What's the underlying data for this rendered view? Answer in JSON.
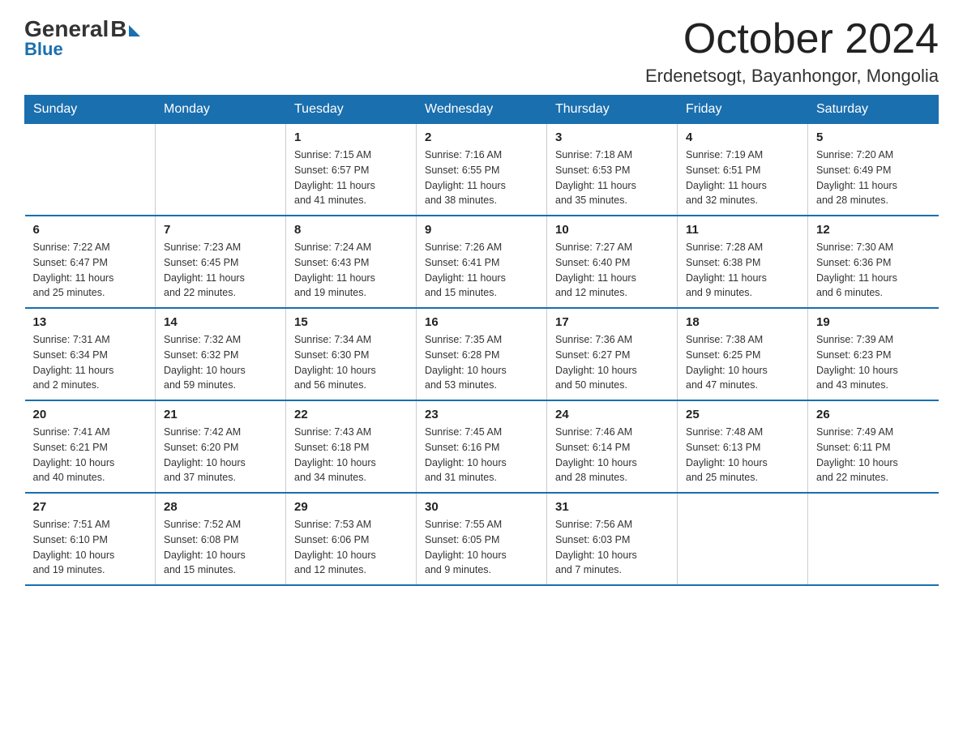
{
  "logo": {
    "general": "General",
    "blue": "Blue"
  },
  "title": "October 2024",
  "location": "Erdenetsogt, Bayanhongor, Mongolia",
  "days_of_week": [
    "Sunday",
    "Monday",
    "Tuesday",
    "Wednesday",
    "Thursday",
    "Friday",
    "Saturday"
  ],
  "weeks": [
    [
      {
        "day": "",
        "info": ""
      },
      {
        "day": "",
        "info": ""
      },
      {
        "day": "1",
        "info": "Sunrise: 7:15 AM\nSunset: 6:57 PM\nDaylight: 11 hours\nand 41 minutes."
      },
      {
        "day": "2",
        "info": "Sunrise: 7:16 AM\nSunset: 6:55 PM\nDaylight: 11 hours\nand 38 minutes."
      },
      {
        "day": "3",
        "info": "Sunrise: 7:18 AM\nSunset: 6:53 PM\nDaylight: 11 hours\nand 35 minutes."
      },
      {
        "day": "4",
        "info": "Sunrise: 7:19 AM\nSunset: 6:51 PM\nDaylight: 11 hours\nand 32 minutes."
      },
      {
        "day": "5",
        "info": "Sunrise: 7:20 AM\nSunset: 6:49 PM\nDaylight: 11 hours\nand 28 minutes."
      }
    ],
    [
      {
        "day": "6",
        "info": "Sunrise: 7:22 AM\nSunset: 6:47 PM\nDaylight: 11 hours\nand 25 minutes."
      },
      {
        "day": "7",
        "info": "Sunrise: 7:23 AM\nSunset: 6:45 PM\nDaylight: 11 hours\nand 22 minutes."
      },
      {
        "day": "8",
        "info": "Sunrise: 7:24 AM\nSunset: 6:43 PM\nDaylight: 11 hours\nand 19 minutes."
      },
      {
        "day": "9",
        "info": "Sunrise: 7:26 AM\nSunset: 6:41 PM\nDaylight: 11 hours\nand 15 minutes."
      },
      {
        "day": "10",
        "info": "Sunrise: 7:27 AM\nSunset: 6:40 PM\nDaylight: 11 hours\nand 12 minutes."
      },
      {
        "day": "11",
        "info": "Sunrise: 7:28 AM\nSunset: 6:38 PM\nDaylight: 11 hours\nand 9 minutes."
      },
      {
        "day": "12",
        "info": "Sunrise: 7:30 AM\nSunset: 6:36 PM\nDaylight: 11 hours\nand 6 minutes."
      }
    ],
    [
      {
        "day": "13",
        "info": "Sunrise: 7:31 AM\nSunset: 6:34 PM\nDaylight: 11 hours\nand 2 minutes."
      },
      {
        "day": "14",
        "info": "Sunrise: 7:32 AM\nSunset: 6:32 PM\nDaylight: 10 hours\nand 59 minutes."
      },
      {
        "day": "15",
        "info": "Sunrise: 7:34 AM\nSunset: 6:30 PM\nDaylight: 10 hours\nand 56 minutes."
      },
      {
        "day": "16",
        "info": "Sunrise: 7:35 AM\nSunset: 6:28 PM\nDaylight: 10 hours\nand 53 minutes."
      },
      {
        "day": "17",
        "info": "Sunrise: 7:36 AM\nSunset: 6:27 PM\nDaylight: 10 hours\nand 50 minutes."
      },
      {
        "day": "18",
        "info": "Sunrise: 7:38 AM\nSunset: 6:25 PM\nDaylight: 10 hours\nand 47 minutes."
      },
      {
        "day": "19",
        "info": "Sunrise: 7:39 AM\nSunset: 6:23 PM\nDaylight: 10 hours\nand 43 minutes."
      }
    ],
    [
      {
        "day": "20",
        "info": "Sunrise: 7:41 AM\nSunset: 6:21 PM\nDaylight: 10 hours\nand 40 minutes."
      },
      {
        "day": "21",
        "info": "Sunrise: 7:42 AM\nSunset: 6:20 PM\nDaylight: 10 hours\nand 37 minutes."
      },
      {
        "day": "22",
        "info": "Sunrise: 7:43 AM\nSunset: 6:18 PM\nDaylight: 10 hours\nand 34 minutes."
      },
      {
        "day": "23",
        "info": "Sunrise: 7:45 AM\nSunset: 6:16 PM\nDaylight: 10 hours\nand 31 minutes."
      },
      {
        "day": "24",
        "info": "Sunrise: 7:46 AM\nSunset: 6:14 PM\nDaylight: 10 hours\nand 28 minutes."
      },
      {
        "day": "25",
        "info": "Sunrise: 7:48 AM\nSunset: 6:13 PM\nDaylight: 10 hours\nand 25 minutes."
      },
      {
        "day": "26",
        "info": "Sunrise: 7:49 AM\nSunset: 6:11 PM\nDaylight: 10 hours\nand 22 minutes."
      }
    ],
    [
      {
        "day": "27",
        "info": "Sunrise: 7:51 AM\nSunset: 6:10 PM\nDaylight: 10 hours\nand 19 minutes."
      },
      {
        "day": "28",
        "info": "Sunrise: 7:52 AM\nSunset: 6:08 PM\nDaylight: 10 hours\nand 15 minutes."
      },
      {
        "day": "29",
        "info": "Sunrise: 7:53 AM\nSunset: 6:06 PM\nDaylight: 10 hours\nand 12 minutes."
      },
      {
        "day": "30",
        "info": "Sunrise: 7:55 AM\nSunset: 6:05 PM\nDaylight: 10 hours\nand 9 minutes."
      },
      {
        "day": "31",
        "info": "Sunrise: 7:56 AM\nSunset: 6:03 PM\nDaylight: 10 hours\nand 7 minutes."
      },
      {
        "day": "",
        "info": ""
      },
      {
        "day": "",
        "info": ""
      }
    ]
  ]
}
